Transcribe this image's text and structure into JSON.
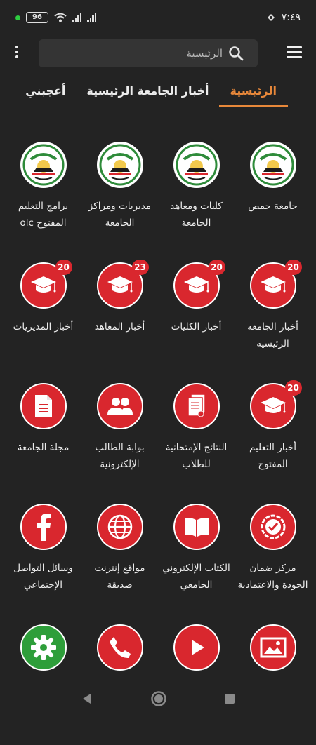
{
  "status": {
    "time": "٧:٤٩",
    "battery": "96"
  },
  "search": {
    "placeholder": "الرئيسية"
  },
  "tabs": [
    {
      "label": "الرئيسية",
      "active": true
    },
    {
      "label": "أخبار الجامعة الرئيسية",
      "active": false
    },
    {
      "label": "أعجبني",
      "active": false
    }
  ],
  "tiles": [
    {
      "label": "جامعة حمص",
      "icon": "university-logo-icon",
      "badge": ""
    },
    {
      "label": "كليات ومعاهد الجامعة",
      "icon": "university-logo-icon",
      "badge": ""
    },
    {
      "label": "مديريات ومراكز الجامعة",
      "icon": "university-logo-icon",
      "badge": ""
    },
    {
      "label": "برامج التعليم المفتوح olc",
      "icon": "university-logo-icon",
      "badge": ""
    },
    {
      "label": "أخبار الجامعة الرئيسية",
      "icon": "graduation-cap-icon",
      "badge": "20"
    },
    {
      "label": "أخبار الكليات",
      "icon": "graduation-cap-icon",
      "badge": "20"
    },
    {
      "label": "أخبار المعاهد",
      "icon": "graduation-cap-icon",
      "badge": "23"
    },
    {
      "label": "أخبار المديريات",
      "icon": "graduation-cap-icon",
      "badge": "20"
    },
    {
      "label": "أخبار التعليم المفتوح",
      "icon": "graduation-cap-icon",
      "badge": "20"
    },
    {
      "label": "النتائج الإمتحانية للطلاب",
      "icon": "documents-icon",
      "badge": ""
    },
    {
      "label": "بوابة الطالب الإلكترونية",
      "icon": "users-icon",
      "badge": ""
    },
    {
      "label": "مجلة الجامعة",
      "icon": "document-icon",
      "badge": ""
    },
    {
      "label": "مركز ضمان الجودة والاعتمادية",
      "icon": "quality-seal-icon",
      "badge": ""
    },
    {
      "label": "الكتاب الإلكتروني الجامعي",
      "icon": "book-icon",
      "badge": ""
    },
    {
      "label": "مواقع إنترنت صديقة",
      "icon": "globe-icon",
      "badge": ""
    },
    {
      "label": "وسائل التواصل الإجتماعي",
      "icon": "facebook-icon",
      "badge": ""
    },
    {
      "label": "",
      "icon": "image-icon",
      "badge": ""
    },
    {
      "label": "",
      "icon": "play-icon",
      "badge": ""
    },
    {
      "label": "",
      "icon": "phone-icon",
      "badge": ""
    },
    {
      "label": "",
      "icon": "settings-icon",
      "badge": ""
    }
  ],
  "colors": {
    "background": "#232323",
    "accent": "#e8883a",
    "icon_red": "#d9272e",
    "icon_green": "#2e9e3a"
  }
}
